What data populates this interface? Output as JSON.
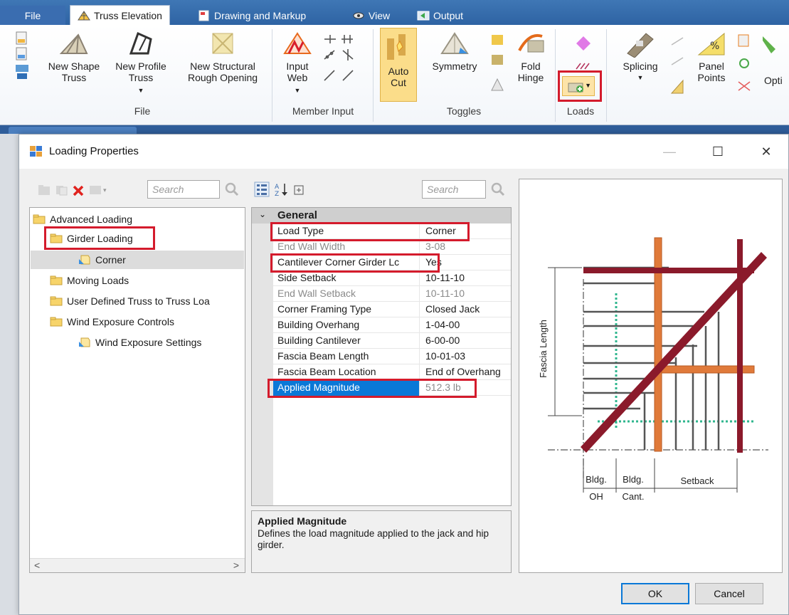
{
  "ribbon": {
    "tabs": [
      {
        "label": "File"
      },
      {
        "label": "Truss Elevation"
      },
      {
        "label": "Drawing and Markup"
      },
      {
        "label": "View"
      },
      {
        "label": "Output"
      }
    ],
    "file_group": {
      "label": "File",
      "buttons": [
        "New Shape\nTruss",
        "New Profile\nTruss",
        "New Structural\nRough Opening"
      ],
      "new_shape_truss": "New Shape\nTruss",
      "new_profile_truss": "New Profile\nTruss",
      "new_structural": "New Structural\nRough Opening"
    },
    "member_input_group": {
      "label": "Member Input",
      "input_web": "Input\nWeb"
    },
    "toggles_group": {
      "label": "Toggles",
      "auto_cut": "Auto\nCut",
      "symmetry": "Symmetry",
      "fold_hinge": "Fold\nHinge"
    },
    "loads_group": {
      "label": "Loads"
    },
    "splicing": "Splicing",
    "panel_points": "Panel\nPoints",
    "options_partial": "Opti"
  },
  "dialog": {
    "title": "Loading Properties",
    "left_search_placeholder": "Search",
    "mid_search_placeholder": "Search",
    "tree": {
      "items": [
        {
          "label": "Advanced Loading",
          "level": 0
        },
        {
          "label": "Girder Loading",
          "level": 1
        },
        {
          "label": "Corner",
          "level": 2
        },
        {
          "label": "Moving Loads",
          "level": 1
        },
        {
          "label": "User Defined Truss to Truss Loa",
          "level": 1
        },
        {
          "label": "Wind Exposure Controls",
          "level": 1
        },
        {
          "label": "Wind Exposure Settings",
          "level": 2
        }
      ]
    },
    "property_grid": {
      "category": "General",
      "rows": [
        {
          "name": "Load Type",
          "value": "Corner"
        },
        {
          "name": "End Wall Width",
          "value": "3-08"
        },
        {
          "name": "Cantilever Corner Girder Lc",
          "value": "Yes"
        },
        {
          "name": "Side Setback",
          "value": "10-11-10"
        },
        {
          "name": "End Wall Setback",
          "value": "10-11-10"
        },
        {
          "name": "Corner Framing Type",
          "value": "Closed Jack"
        },
        {
          "name": "Building Overhang",
          "value": "1-04-00"
        },
        {
          "name": "Building Cantilever",
          "value": "6-00-00"
        },
        {
          "name": "Fascia Beam Length",
          "value": "10-01-03"
        },
        {
          "name": "Fascia Beam Location",
          "value": "End of Overhang"
        },
        {
          "name": "Applied Magnitude",
          "value": "512.3 lb"
        }
      ]
    },
    "help": {
      "title": "Applied Magnitude",
      "description": "Defines the load magnitude applied to the jack and hip girder."
    },
    "diagram": {
      "fascia_length_label": "Fascia Length",
      "bldg_oh_top": "Bldg.",
      "bldg_oh_bottom": "OH",
      "bldg_cant_top": "Bldg.",
      "bldg_cant_bottom": "Cant.",
      "setback_label": "Setback"
    },
    "buttons": {
      "ok": "OK",
      "cancel": "Cancel"
    },
    "window_controls": {
      "minimize": "—",
      "maximize": "☐",
      "close": "✕"
    }
  },
  "colors": {
    "ribbon_blue": "#2e63a3",
    "highlight_red": "#d41b2c",
    "selection_blue": "#0a78d7",
    "beam_dark_red": "#8b1a2b",
    "beam_orange": "#e07a3a",
    "guide_green": "#2fb68e"
  }
}
